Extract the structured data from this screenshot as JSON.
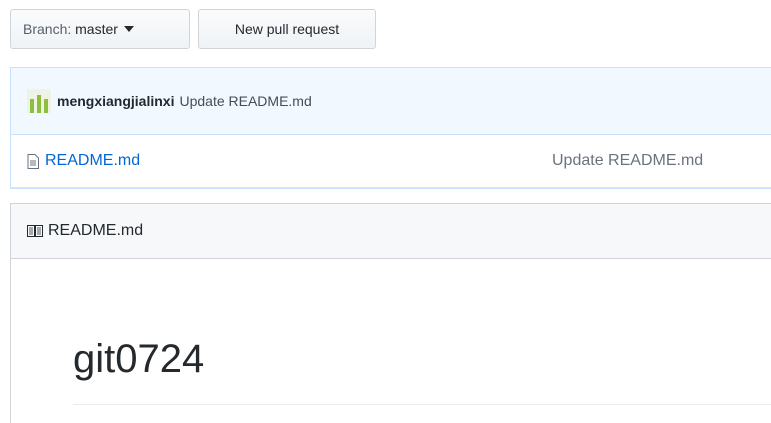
{
  "toolbar": {
    "branch_prefix": "Branch:",
    "branch_name": "master",
    "new_pr_label": "New pull request"
  },
  "commit": {
    "author": "mengxiangjialinxi",
    "message": "Update README.md"
  },
  "files": [
    {
      "name": "README.md",
      "commit_message": "Update README.md"
    }
  ],
  "readme": {
    "header_label": "README.md",
    "title": "git0724"
  },
  "colors": {
    "link": "#0366d6",
    "commit_bar_bg": "#f1f8ff",
    "avatar_green": "#8cbf3f"
  }
}
